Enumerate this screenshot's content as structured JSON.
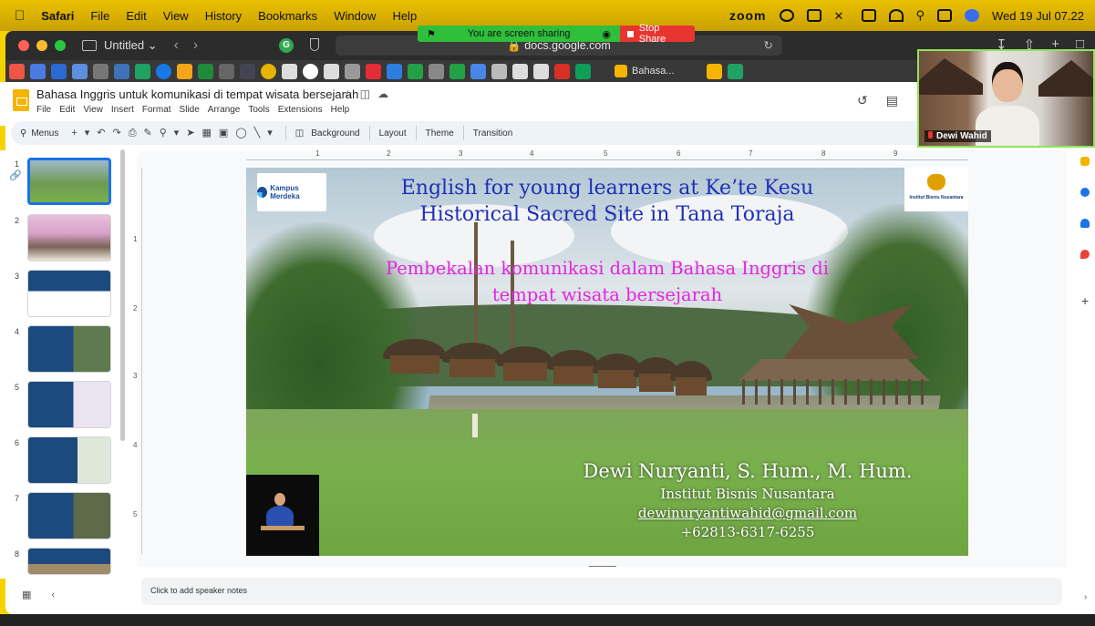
{
  "macos": {
    "app": "Safari",
    "menus": [
      "File",
      "Edit",
      "View",
      "History",
      "Bookmarks",
      "Window",
      "Help"
    ],
    "zoom": "zoom",
    "datetime": "Wed 19 Jul 07.22"
  },
  "sharing": {
    "status": "You are screen sharing",
    "stop": "Stop Share"
  },
  "browser": {
    "tab_group": "Untitled",
    "url": "docs.google.com",
    "bookmark_tab": "Bahasa..."
  },
  "slides": {
    "doc_title": "Bahasa Inggris untuk komunikasi di tempat wisata  bersejarah",
    "menus": [
      "File",
      "Edit",
      "View",
      "Insert",
      "Format",
      "Slide",
      "Arrange",
      "Tools",
      "Extensions",
      "Help"
    ],
    "toolbar": {
      "search": "Menus",
      "background": "Background",
      "layout": "Layout",
      "theme": "Theme",
      "transition": "Transition"
    },
    "thumbnails": [
      "1",
      "2",
      "3",
      "4",
      "5",
      "6",
      "7",
      "8"
    ],
    "ruler_h": [
      "1",
      "2",
      "3",
      "4",
      "5",
      "6",
      "7",
      "8",
      "9"
    ],
    "ruler_v": [
      "1",
      "2",
      "3",
      "4",
      "5"
    ],
    "notes_placeholder": "Click to add speaker notes"
  },
  "slide": {
    "logo_left": "Kampus Merdeka",
    "logo_right": "Institut Bisnis Nusantara",
    "title_line1": "English for young learners at Ke’te Kesu",
    "title_line2": "Historical Sacred Site in Tana Toraja",
    "subtitle_line1": "Pembekalan komunikasi dalam Bahasa Inggris di",
    "subtitle_line2": "tempat wisata  bersejarah",
    "speaker_name": "Dewi Nuryanti, S. Hum., M. Hum.",
    "institution": "Institut Bisnis Nusantara",
    "email": "dewinuryantiwahid@gmail.com",
    "phone": "+62813-6317-6255"
  },
  "video": {
    "participant": "Dewi Wahid"
  },
  "colors": {
    "title": "#1f2fb8",
    "subtitle": "#e623df",
    "accent": "#1a73e8",
    "share_green": "#2fbf3a",
    "share_red": "#e8352f"
  }
}
